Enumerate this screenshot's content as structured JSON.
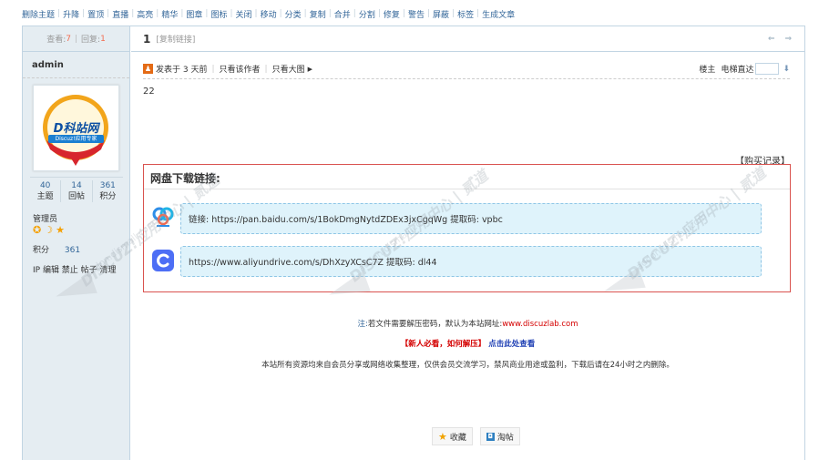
{
  "modbar": {
    "items": [
      "删除主题",
      "升降",
      "置顶",
      "直播",
      "高亮",
      "精华",
      "图章",
      "图标",
      "关闭",
      "移动",
      "分类",
      "复制",
      "合并",
      "分割",
      "修复",
      "警告",
      "屏蔽",
      "标签",
      "生成文章"
    ]
  },
  "stats": {
    "views_label": "查看:",
    "views": "7",
    "replies_label": "回复:",
    "replies": "1"
  },
  "author": {
    "name": "admin",
    "avatar_brand": "D科站网",
    "avatar_tagline": "Discuz!应用专家",
    "threads": "40",
    "threads_label": "主题",
    "posts": "14",
    "posts_label": "回帖",
    "credits": "361",
    "credits_label": "积分",
    "group": "管理员",
    "credit_line_label": "积分",
    "credit_line_value": "361",
    "admin_links": "IP 编辑 禁止 帖子 清理"
  },
  "post": {
    "floor": "1",
    "copy_link": "[复制链接]",
    "nav_arrows": "⇐ ⇒",
    "posted_time": "发表于 3 天前",
    "author_only": "只看该作者",
    "big_image": "只看大图",
    "floor_label": "楼主",
    "jump_label": "电梯直达",
    "jump_value": "",
    "content": "22",
    "purchase_record": "【购买记录】"
  },
  "download": {
    "title": "网盘下载链接:",
    "links": [
      {
        "text": "链接: https://pan.baidu.com/s/1BokDmgNytdZDEx3jxCgqWg 提取码: vpbc",
        "icon": "baidu-netdisk-icon"
      },
      {
        "text": "https://www.aliyundrive.com/s/DhXzyXCsC7Z 提取码: dl44",
        "icon": "aliyun-drive-icon"
      }
    ]
  },
  "notice": {
    "prefix": "注:",
    "text": "若文件需要解压密码，默认为本站网址:",
    "url": "www.discuzlab.com"
  },
  "new_notice": {
    "red": "【新人必看，如何解压】",
    "blue": "点击此处查看"
  },
  "disclaimer": "本站所有资源均来自会员分享或网络收集整理，仅供会员交流学习，禁风商业用途或盈利，下载后请在24小时之内删除。",
  "actions": {
    "favorite": "收藏",
    "tao": "淘帖"
  },
  "watermark": {
    "text": "DISCUZ!应用中心 | 贰道",
    "url": "addon.dismall.com"
  },
  "colors": {
    "border": "#c2d5e3",
    "sidebar_bg": "#e5edf2",
    "link": "#336699",
    "alert": "#d9534f"
  }
}
